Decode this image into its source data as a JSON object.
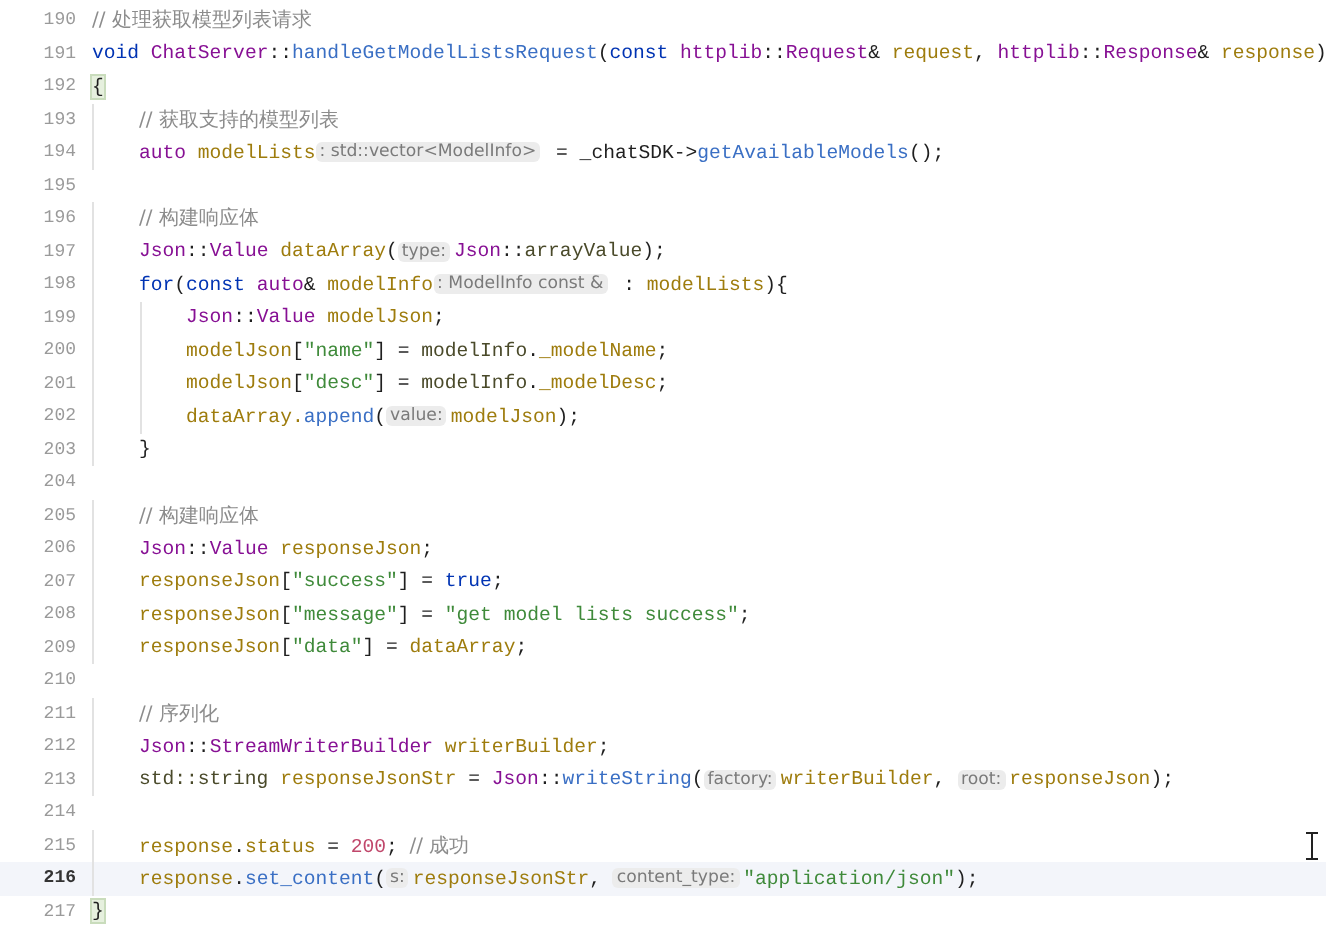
{
  "editor": {
    "lines": [
      {
        "number": "190",
        "current": false,
        "tokens": [
          {
            "kind": "cmt",
            "text": "// 处理获取模型列表请求"
          }
        ]
      },
      {
        "number": "191",
        "current": false,
        "tokens": [
          {
            "kind": "kw",
            "text": "void "
          },
          {
            "kind": "type",
            "text": "ChatServer"
          },
          {
            "kind": "p",
            "text": "::"
          },
          {
            "kind": "fn",
            "text": "handleGetModelListsRequest"
          },
          {
            "kind": "p",
            "text": "("
          },
          {
            "kind": "kw",
            "text": "const "
          },
          {
            "kind": "type",
            "text": "httplib"
          },
          {
            "kind": "p",
            "text": "::"
          },
          {
            "kind": "type",
            "text": "Request"
          },
          {
            "kind": "p",
            "text": "& "
          },
          {
            "kind": "var",
            "text": "request"
          },
          {
            "kind": "p",
            "text": ", "
          },
          {
            "kind": "type",
            "text": "httplib"
          },
          {
            "kind": "p",
            "text": "::"
          },
          {
            "kind": "type",
            "text": "Response"
          },
          {
            "kind": "p",
            "text": "& "
          },
          {
            "kind": "var",
            "text": "response"
          },
          {
            "kind": "p",
            "text": ")"
          }
        ]
      },
      {
        "number": "192",
        "current": false,
        "tokens": [
          {
            "kind": "match",
            "text": "{"
          }
        ]
      },
      {
        "number": "193",
        "current": false,
        "tokens": [
          {
            "kind": "cmt",
            "text": "    // 获取支持的模型列表"
          }
        ]
      },
      {
        "number": "194",
        "current": false,
        "tokens": [
          {
            "kind": "kw2",
            "text": "    auto "
          },
          {
            "kind": "var",
            "text": "modelLists"
          },
          {
            "kind": "hint",
            "text": ": std::vector<ModelInfo>"
          },
          {
            "kind": "p",
            "text": " = _chatSDK->"
          },
          {
            "kind": "fn",
            "text": "getAvailableModels"
          },
          {
            "kind": "p",
            "text": "();"
          }
        ]
      },
      {
        "number": "195",
        "current": false
      },
      {
        "number": "196",
        "current": false,
        "tokens": [
          {
            "kind": "cmt",
            "text": "    // 构建响应体"
          }
        ]
      },
      {
        "number": "197",
        "current": false,
        "tokens": [
          {
            "kind": "type",
            "text": "    Json"
          },
          {
            "kind": "p",
            "text": "::"
          },
          {
            "kind": "type",
            "text": "Value "
          },
          {
            "kind": "var",
            "text": "dataArray"
          },
          {
            "kind": "p",
            "text": "("
          },
          {
            "kind": "hint",
            "text": "type:"
          },
          {
            "kind": "type",
            "text": "Json"
          },
          {
            "kind": "p",
            "text": "::"
          },
          {
            "kind": "field",
            "text": "arrayValue"
          },
          {
            "kind": "p",
            "text": ");"
          }
        ]
      },
      {
        "number": "198",
        "current": false,
        "tokens": [
          {
            "kind": "kw",
            "text": "    for"
          },
          {
            "kind": "p",
            "text": "("
          },
          {
            "kind": "kw",
            "text": "const "
          },
          {
            "kind": "kw2",
            "text": "auto"
          },
          {
            "kind": "p",
            "text": "& "
          },
          {
            "kind": "var",
            "text": "modelInfo"
          },
          {
            "kind": "hint",
            "text": ": ModelInfo const &"
          },
          {
            "kind": "p",
            "text": " : "
          },
          {
            "kind": "var",
            "text": "modelLists"
          },
          {
            "kind": "p",
            "text": "){"
          }
        ]
      },
      {
        "number": "199",
        "current": false,
        "tokens": [
          {
            "kind": "type",
            "text": "        Json"
          },
          {
            "kind": "p",
            "text": "::"
          },
          {
            "kind": "type",
            "text": "Value "
          },
          {
            "kind": "var",
            "text": "modelJson"
          },
          {
            "kind": "p",
            "text": ";"
          }
        ]
      },
      {
        "number": "200",
        "current": false,
        "tokens": [
          {
            "kind": "var",
            "text": "        modelJson"
          },
          {
            "kind": "p",
            "text": "["
          },
          {
            "kind": "str",
            "text": "\"name\""
          },
          {
            "kind": "p",
            "text": "] = "
          },
          {
            "kind": "field",
            "text": "modelInfo"
          },
          {
            "kind": "p",
            "text": "."
          },
          {
            "kind": "var",
            "text": "_modelName"
          },
          {
            "kind": "p",
            "text": ";"
          }
        ]
      },
      {
        "number": "201",
        "current": false,
        "tokens": [
          {
            "kind": "var",
            "text": "        modelJson"
          },
          {
            "kind": "p",
            "text": "["
          },
          {
            "kind": "str",
            "text": "\"desc\""
          },
          {
            "kind": "p",
            "text": "] = "
          },
          {
            "kind": "field",
            "text": "modelInfo"
          },
          {
            "kind": "p",
            "text": "."
          },
          {
            "kind": "var",
            "text": "_modelDesc"
          },
          {
            "kind": "p",
            "text": ";"
          }
        ]
      },
      {
        "number": "202",
        "current": false,
        "tokens": [
          {
            "kind": "var",
            "text": "        dataArray."
          },
          {
            "kind": "fn",
            "text": "append"
          },
          {
            "kind": "p",
            "text": "("
          },
          {
            "kind": "hint",
            "text": "value:"
          },
          {
            "kind": "var",
            "text": "modelJson"
          },
          {
            "kind": "p",
            "text": ");"
          }
        ]
      },
      {
        "number": "203",
        "current": false,
        "tokens": [
          {
            "kind": "p",
            "text": "    }"
          }
        ]
      },
      {
        "number": "204",
        "current": false
      },
      {
        "number": "205",
        "current": false,
        "tokens": [
          {
            "kind": "cmt",
            "text": "    // 构建响应体"
          }
        ]
      },
      {
        "number": "206",
        "current": false,
        "tokens": [
          {
            "kind": "type",
            "text": "    Json"
          },
          {
            "kind": "p",
            "text": "::"
          },
          {
            "kind": "type",
            "text": "Value "
          },
          {
            "kind": "var",
            "text": "responseJson"
          },
          {
            "kind": "p",
            "text": ";"
          }
        ]
      },
      {
        "number": "207",
        "current": false,
        "tokens": [
          {
            "kind": "var",
            "text": "    responseJson"
          },
          {
            "kind": "p",
            "text": "["
          },
          {
            "kind": "str",
            "text": "\"success\""
          },
          {
            "kind": "p",
            "text": "] = "
          },
          {
            "kind": "kw",
            "text": "true"
          },
          {
            "kind": "p",
            "text": ";"
          }
        ]
      },
      {
        "number": "208",
        "current": false,
        "tokens": [
          {
            "kind": "var",
            "text": "    responseJson"
          },
          {
            "kind": "p",
            "text": "["
          },
          {
            "kind": "str",
            "text": "\"message\""
          },
          {
            "kind": "p",
            "text": "] = "
          },
          {
            "kind": "str",
            "text": "\"get model lists success\""
          },
          {
            "kind": "p",
            "text": ";"
          }
        ]
      },
      {
        "number": "209",
        "current": false,
        "tokens": [
          {
            "kind": "var",
            "text": "    responseJson"
          },
          {
            "kind": "p",
            "text": "["
          },
          {
            "kind": "str",
            "text": "\"data\""
          },
          {
            "kind": "p",
            "text": "] = "
          },
          {
            "kind": "var",
            "text": "dataArray"
          },
          {
            "kind": "p",
            "text": ";"
          }
        ]
      },
      {
        "number": "210",
        "current": false
      },
      {
        "number": "211",
        "current": false,
        "tokens": [
          {
            "kind": "cmt",
            "text": "    // 序列化"
          }
        ]
      },
      {
        "number": "212",
        "current": false,
        "tokens": [
          {
            "kind": "type",
            "text": "    Json"
          },
          {
            "kind": "p",
            "text": "::"
          },
          {
            "kind": "type",
            "text": "StreamWriterBuilder "
          },
          {
            "kind": "var",
            "text": "writerBuilder"
          },
          {
            "kind": "p",
            "text": ";"
          }
        ]
      },
      {
        "number": "213",
        "current": false,
        "tokens": [
          {
            "kind": "field",
            "text": "    std::string "
          },
          {
            "kind": "var",
            "text": "responseJsonStr"
          },
          {
            "kind": "p",
            "text": " = "
          },
          {
            "kind": "type",
            "text": "Json"
          },
          {
            "kind": "p",
            "text": "::"
          },
          {
            "kind": "fn",
            "text": "writeString"
          },
          {
            "kind": "p",
            "text": "("
          },
          {
            "kind": "hint",
            "text": "factory:"
          },
          {
            "kind": "var",
            "text": "writerBuilder"
          },
          {
            "kind": "p",
            "text": ", "
          },
          {
            "kind": "hint",
            "text": "root:"
          },
          {
            "kind": "var",
            "text": "responseJson"
          },
          {
            "kind": "p",
            "text": ");"
          }
        ]
      },
      {
        "number": "214",
        "current": false
      },
      {
        "number": "215",
        "current": false,
        "tokens": [
          {
            "kind": "var",
            "text": "    response"
          },
          {
            "kind": "p",
            "text": "."
          },
          {
            "kind": "var",
            "text": "status"
          },
          {
            "kind": "p",
            "text": " = "
          },
          {
            "kind": "num",
            "text": "200"
          },
          {
            "kind": "p",
            "text": "; "
          },
          {
            "kind": "cmt",
            "text": "// 成功"
          }
        ]
      },
      {
        "number": "216",
        "current": true,
        "tokens": [
          {
            "kind": "var",
            "text": "    response"
          },
          {
            "kind": "p",
            "text": "."
          },
          {
            "kind": "fn",
            "text": "set_content"
          },
          {
            "kind": "p",
            "text": "("
          },
          {
            "kind": "hint",
            "text": "s:"
          },
          {
            "kind": "var",
            "text": "responseJsonStr"
          },
          {
            "kind": "p",
            "text": ", "
          },
          {
            "kind": "hint",
            "text": "content_type:"
          },
          {
            "kind": "str",
            "text": "\"application/json\""
          },
          {
            "kind": "p",
            "text": ");"
          }
        ]
      },
      {
        "number": "217",
        "current": false,
        "tokens": [
          {
            "kind": "match",
            "text": "}"
          }
        ]
      }
    ]
  }
}
